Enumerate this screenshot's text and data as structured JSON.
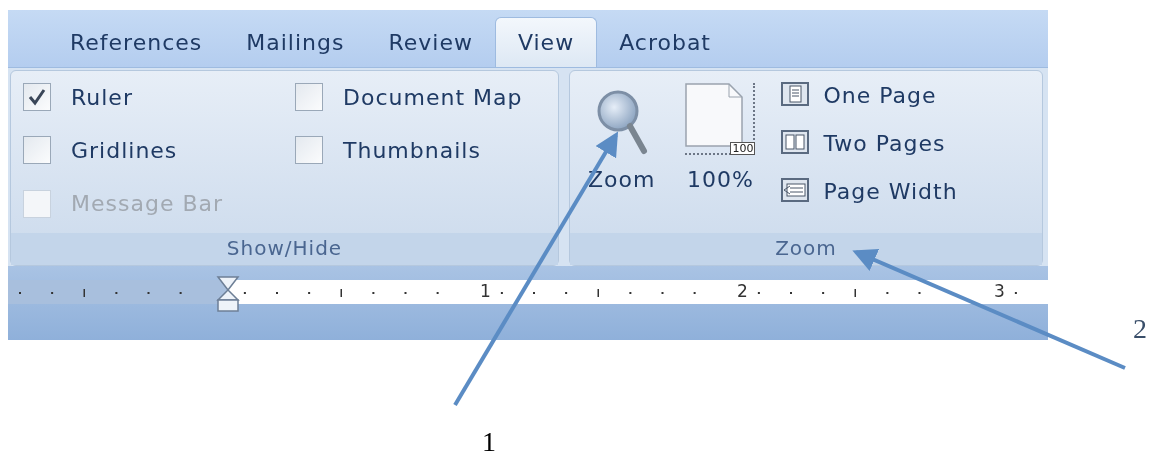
{
  "tabs": [
    {
      "label": "References",
      "selected": false
    },
    {
      "label": "Mailings",
      "selected": false
    },
    {
      "label": "Review",
      "selected": false
    },
    {
      "label": "View",
      "selected": true
    },
    {
      "label": "Acrobat",
      "selected": false
    }
  ],
  "show_hide": {
    "label": "Show/Hide",
    "options": [
      {
        "label": "Ruler",
        "checked": true,
        "disabled": false
      },
      {
        "label": "Gridlines",
        "checked": false,
        "disabled": false
      },
      {
        "label": "Message Bar",
        "checked": false,
        "disabled": true
      },
      {
        "label": "Document Map",
        "checked": false,
        "disabled": false
      },
      {
        "label": "Thumbnails",
        "checked": false,
        "disabled": false
      }
    ]
  },
  "zoom_group": {
    "label": "Zoom",
    "buttons": [
      {
        "kind": "zoom",
        "label": "Zoom"
      },
      {
        "kind": "actual-size",
        "label": "100%",
        "badge": "100"
      }
    ],
    "views": [
      {
        "kind": "one-page",
        "label": "One Page"
      },
      {
        "kind": "two-pages",
        "label": "Two Pages"
      },
      {
        "kind": "page-width",
        "label": "Page Width"
      }
    ]
  },
  "ruler": {
    "numbers": [
      "1",
      "2",
      "3"
    ]
  },
  "callouts": [
    {
      "label": "1"
    },
    {
      "label": "2"
    }
  ]
}
